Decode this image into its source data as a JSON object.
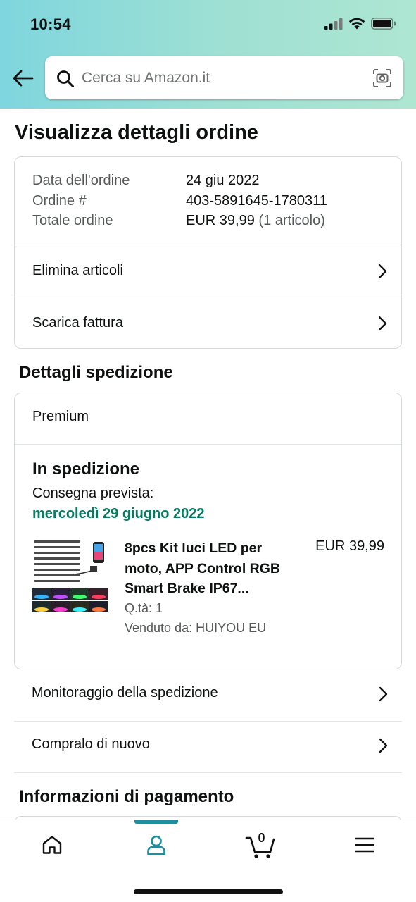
{
  "status_bar": {
    "time": "10:54"
  },
  "search": {
    "placeholder": "Cerca su Amazon.it"
  },
  "page": {
    "title": "Visualizza dettagli ordine"
  },
  "order_summary": {
    "date_label": "Data dell'ordine",
    "date_value": "24 giu 2022",
    "order_label": "Ordine #",
    "order_value": "403-5891645-1780311",
    "total_label": "Totale ordine",
    "total_value": "EUR 39,99",
    "total_count": "(1 articolo)",
    "actions": [
      "Elimina articoli",
      "Scarica fattura"
    ]
  },
  "shipment": {
    "section_title": "Dettagli spedizione",
    "method": "Premium",
    "status": "In spedizione",
    "delivery_label": "Consegna prevista:",
    "delivery_date": "mercoledì 29 giugno 2022",
    "product": {
      "title_line1": "8pcs Kit luci LED per",
      "title_line2": "moto, APP Control RGB",
      "title_line3": "Smart Brake IP67...",
      "price": "EUR 39,99",
      "qty": "Q.tà: 1",
      "seller": "Venduto da: HUIYOU EU"
    }
  },
  "shipment_actions": [
    "Monitoraggio della spedizione",
    "Compralo di nuovo"
  ],
  "payment": {
    "section_title": "Informazioni di pagamento"
  },
  "tabbar": {
    "cart_count": "0",
    "active_tab": "account",
    "accent": "#1b8fa0"
  },
  "colors": {
    "delivery_green": "#067d62",
    "header_gradient_start": "#7fd6de",
    "header_gradient_end": "#aee6d2"
  }
}
